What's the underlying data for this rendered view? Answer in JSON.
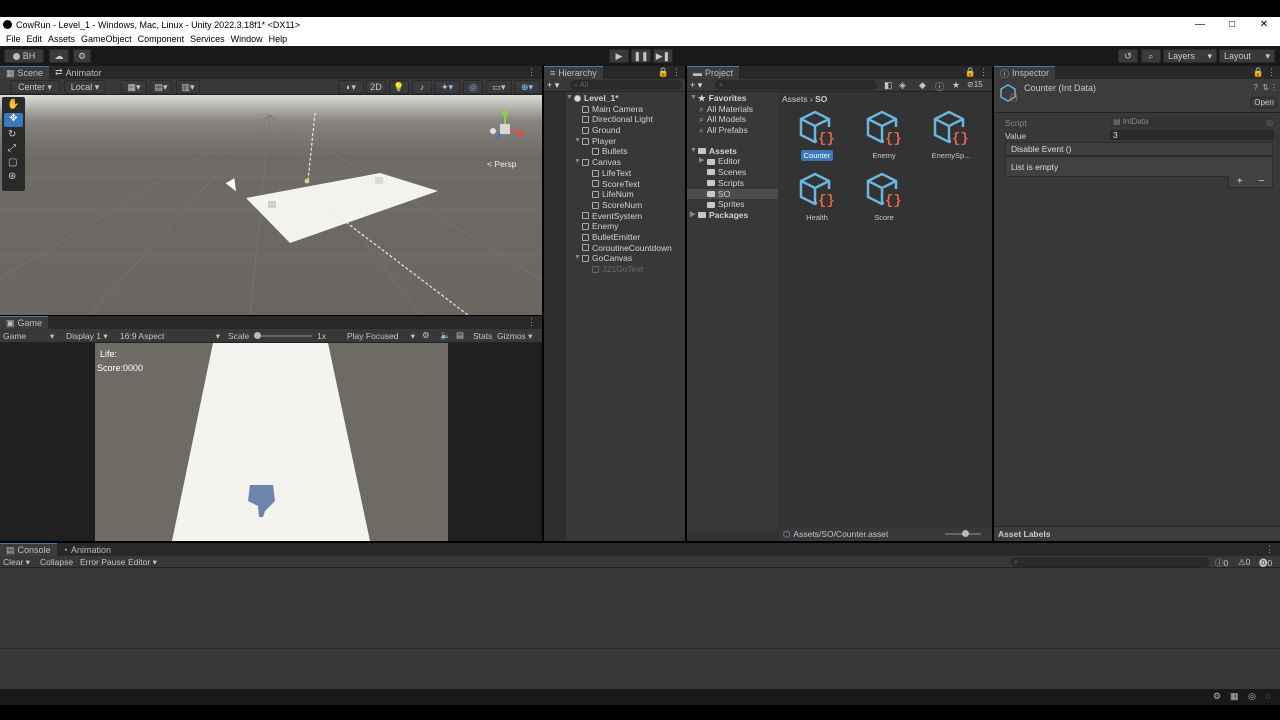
{
  "window": {
    "title": "CowRun - Level_1 - Windows, Mac, Linux - Unity 2022.3.18f1* <DX11>",
    "controls": [
      "—",
      "□",
      "✕"
    ]
  },
  "menu": [
    "File",
    "Edit",
    "Assets",
    "GameObject",
    "Component",
    "Services",
    "Window",
    "Help"
  ],
  "toolbar": {
    "account": "BH",
    "layers": "Layers",
    "layout": "Layout"
  },
  "scene": {
    "tabs": [
      "Scene",
      "Animator"
    ],
    "pivot": "Center",
    "space": "Local",
    "mode2d": "2D",
    "persp": "< Persp"
  },
  "game": {
    "tab": "Game",
    "view": "Game",
    "display": "Display 1",
    "aspect": "16:9 Aspect",
    "scale_label": "Scale",
    "scale_value": "1x",
    "play_mode": "Play Focused",
    "stats": "Stats",
    "gizmos": "Gizmos",
    "hud_life": "Life:",
    "hud_score": "Score:0000"
  },
  "hierarchy": {
    "tab": "Hierarchy",
    "search_placeholder": "All",
    "items": [
      {
        "label": "Level_1*",
        "depth": 0,
        "arrow": "▼",
        "scene": true
      },
      {
        "label": "Main Camera",
        "depth": 1,
        "arrow": ""
      },
      {
        "label": "Directional Light",
        "depth": 1,
        "arrow": ""
      },
      {
        "label": "Ground",
        "depth": 1,
        "arrow": ""
      },
      {
        "label": "Player",
        "depth": 1,
        "arrow": "▼"
      },
      {
        "label": "Bullets",
        "depth": 2,
        "arrow": ""
      },
      {
        "label": "Canvas",
        "depth": 1,
        "arrow": "▼"
      },
      {
        "label": "LifeText",
        "depth": 2,
        "arrow": ""
      },
      {
        "label": "ScoreText",
        "depth": 2,
        "arrow": ""
      },
      {
        "label": "LifeNum",
        "depth": 2,
        "arrow": ""
      },
      {
        "label": "ScoreNum",
        "depth": 2,
        "arrow": ""
      },
      {
        "label": "EventSystem",
        "depth": 1,
        "arrow": ""
      },
      {
        "label": "Enemy",
        "depth": 1,
        "arrow": ""
      },
      {
        "label": "BulletEmitter",
        "depth": 1,
        "arrow": ""
      },
      {
        "label": "CoroutineCountdown",
        "depth": 1,
        "arrow": ""
      },
      {
        "label": "GoCanvas",
        "depth": 1,
        "arrow": "▼"
      },
      {
        "label": "321GoText",
        "depth": 2,
        "arrow": "",
        "inactive": true
      }
    ]
  },
  "project": {
    "tab": "Project",
    "favorites_label": "Favorites",
    "favorites": [
      "All Materials",
      "All Models",
      "All Prefabs"
    ],
    "assets_label": "Assets",
    "folders": [
      {
        "label": "Editor",
        "arrow": "▶"
      },
      {
        "label": "Scenes",
        "arrow": ""
      },
      {
        "label": "Scripts",
        "arrow": ""
      },
      {
        "label": "SO",
        "arrow": "",
        "selected": true
      },
      {
        "label": "Sprites",
        "arrow": ""
      }
    ],
    "packages_label": "Packages",
    "breadcrumb": [
      "Assets",
      "SO"
    ],
    "hidden_count": "15",
    "items": [
      "Counter",
      "Enemy",
      "EnemySp...",
      "Health",
      "Score"
    ],
    "selected_item": "Counter",
    "status_path": "Assets/SO/Counter.asset"
  },
  "inspector": {
    "tab": "Inspector",
    "object_title": "Counter (Int Data)",
    "open_button": "Open",
    "script_label": "Script",
    "script_value": "IntData",
    "value_label": "Value",
    "value": "3",
    "event_header": "Disable Event ()",
    "event_empty": "List is empty",
    "add": "+",
    "remove": "−",
    "asset_labels": "Asset Labels"
  },
  "console": {
    "tabs": [
      "Console",
      "Animation"
    ],
    "buttons": [
      "Clear",
      "Collapse",
      "Error Pause",
      "Editor"
    ],
    "log_count": "0",
    "warn_count": "0",
    "error_count": "0"
  },
  "colors": {
    "accent": "#3a79bb",
    "asset_icon": "#6ab6de",
    "asset_brace": "#e0654a"
  }
}
